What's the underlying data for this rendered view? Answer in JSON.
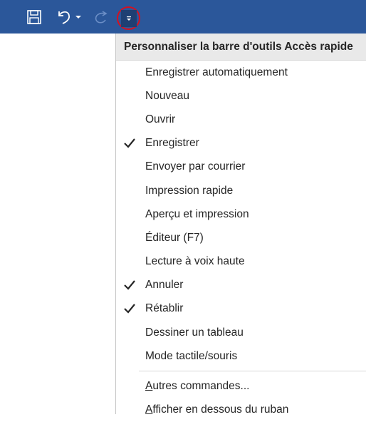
{
  "toolbar": {
    "buttons": [
      {
        "name": "save",
        "icon": "floppy-disk-icon"
      },
      {
        "name": "undo",
        "icon": "undo-arrow-icon"
      },
      {
        "name": "redo",
        "icon": "redo-arrow-icon"
      },
      {
        "name": "customize",
        "icon": "chevron-down-icon"
      }
    ],
    "background": "#2b579a"
  },
  "menu": {
    "title": "Personnaliser la barre d'outils Accès rapide",
    "items": [
      {
        "label": "Enregistrer automatiquement",
        "checked": false
      },
      {
        "label": "Nouveau",
        "checked": false
      },
      {
        "label": "Ouvrir",
        "checked": false
      },
      {
        "label": "Enregistrer",
        "checked": true
      },
      {
        "label": "Envoyer par courrier",
        "checked": false
      },
      {
        "label": "Impression rapide",
        "checked": false
      },
      {
        "label": "Aperçu et impression",
        "checked": false
      },
      {
        "label": "Éditeur (F7)",
        "checked": false
      },
      {
        "label": "Lecture à voix haute",
        "checked": false
      },
      {
        "label": "Annuler",
        "checked": true
      },
      {
        "label": "Rétablir",
        "checked": true
      },
      {
        "label": "Dessiner un tableau",
        "checked": false
      },
      {
        "label": "Mode tactile/souris",
        "checked": false
      }
    ],
    "more_commands": {
      "first": "A",
      "rest": "utres commandes..."
    },
    "show_below": {
      "first": "A",
      "rest": "fficher en dessous du ruban"
    }
  }
}
